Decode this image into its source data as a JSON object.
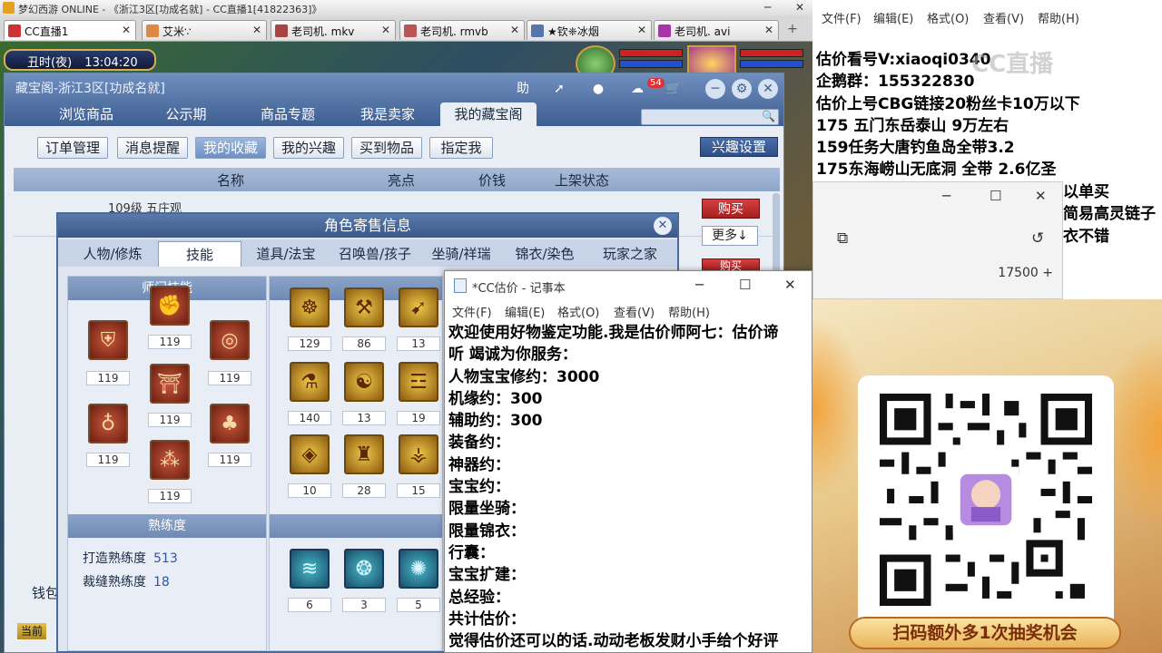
{
  "game_window": {
    "title": "梦幻西游 ONLINE - 《浙江3区[功成名就] - CC直播1[41822363]》",
    "tabs": [
      {
        "label": "CC直播1",
        "active": true
      },
      {
        "label": "艾米∵"
      },
      {
        "label": "老司机. mkv"
      },
      {
        "label": "老司机. rmvb"
      },
      {
        "label": "★钦❈冰烟"
      },
      {
        "label": "老司机. avi"
      }
    ],
    "clock": {
      "period": "丑时(夜)",
      "time": "13:04:20"
    }
  },
  "treasure_panel": {
    "title": "藏宝阁-浙江3区[功成名就]",
    "help_label": "助",
    "message_badge": "54",
    "nav_tabs": [
      "浏览商品",
      "公示期",
      "商品专题",
      "我是卖家",
      "我的藏宝阁"
    ],
    "active_nav": "我的藏宝阁",
    "sub_buttons": [
      "订单管理",
      "消息提醒",
      "我的收藏",
      "我的兴趣",
      "买到物品",
      "指定我"
    ],
    "active_sub": "我的收藏",
    "interest_settings": "兴趣设置",
    "columns": [
      "名称",
      "亮点",
      "价钱",
      "上架状态"
    ],
    "row_name": "109级 五庄观",
    "buy_label": "购买",
    "more_label": "更多↓",
    "wallet_label": "钱包",
    "current_label": "当前"
  },
  "role_popup": {
    "title": "角色寄售信息",
    "tabs": [
      "人物/修炼",
      "技能",
      "道具/法宝",
      "召唤兽/孩子",
      "坐骑/祥瑞",
      "锦衣/染色",
      "玩家之家"
    ],
    "active_tab": "技能",
    "school_skills_title": "师门技能",
    "school_skills": [
      {
        "icon": "shield-icon",
        "level": "119"
      },
      {
        "icon": "fist-icon",
        "level": "119"
      },
      {
        "icon": "swirl-icon",
        "level": "119"
      },
      {
        "icon": "gate-icon",
        "level": "119"
      },
      {
        "icon": "orb-icon",
        "level": "119"
      },
      {
        "icon": "tree-icon",
        "level": "119"
      },
      {
        "icon": "stars-icon",
        "level": "119"
      }
    ],
    "life_skills": [
      {
        "icon": "hands-icon",
        "level": "129"
      },
      {
        "icon": "hammer-icon",
        "level": "86"
      },
      {
        "icon": "needle-icon",
        "level": "13"
      },
      {
        "icon": "flask-icon",
        "level": "140"
      },
      {
        "icon": "mask-icon",
        "level": "13"
      },
      {
        "icon": "rune-icon",
        "level": "19"
      },
      {
        "icon": "crystal-icon",
        "level": "10"
      },
      {
        "icon": "strength-icon",
        "level": "28"
      },
      {
        "icon": "tornado-icon",
        "level": "15"
      },
      {
        "icon": "wave-icon",
        "level": "6"
      },
      {
        "icon": "ring-icon",
        "level": "3"
      },
      {
        "icon": "splash-icon",
        "level": "5"
      }
    ],
    "proficiency_title": "熟练度",
    "proficiency": [
      {
        "label": "打造熟练度",
        "value": "513"
      },
      {
        "label": "裁缝熟练度",
        "value": "18"
      }
    ]
  },
  "notepad": {
    "title": "*CC估价 - 记事本",
    "menu": [
      "文件(F)",
      "编辑(E)",
      "格式(O)",
      "查看(V)",
      "帮助(H)"
    ],
    "lines": [
      "欢迎使用好物鉴定功能.我是估价师阿七：估价谛",
      "听 竭诚为你服务：",
      "人物宝宝修约：3000",
      "机缘约：300",
      "辅助约：300",
      "装备约：",
      "神器约：",
      "宝宝约：",
      "限量坐骑：",
      "限量锦衣：",
      "行囊：",
      "宝宝扩建：",
      "总经验：",
      "共计估价：",
      "觉得估价还可以的话.动动老板发财小手给个好评"
    ]
  },
  "right_panel": {
    "menu": [
      "文件(F)",
      "编辑(E)",
      "格式(O)",
      "查看(V)",
      "帮助(H)"
    ],
    "lines": [
      "估价看号V:xiaoqi0340",
      "企鹅群：155322830",
      "估价上号CBG链接20粉丝卡10万以下",
      "175 五门东岳泰山  9万左右",
      "159任务大唐钓鱼岛全带3.2",
      "175东海崂山无底洞  全带   2.6亿圣"
    ],
    "partial_lines": [
      "以单买",
      "简易高灵链子",
      "衣不错"
    ],
    "logo": "CC直播",
    "calculator_value": "17500 +"
  },
  "promo": {
    "banner": "扫码额外多1次抽奖机会"
  }
}
